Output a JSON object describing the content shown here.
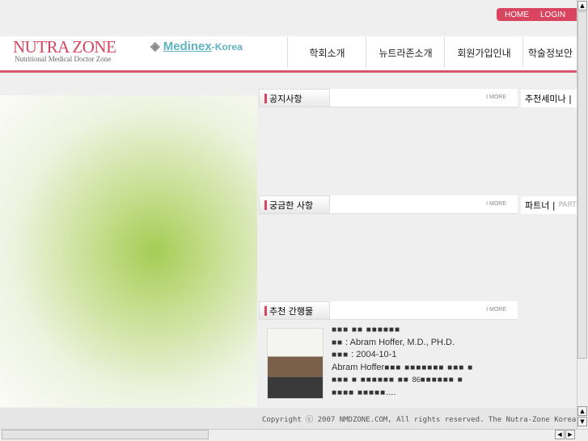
{
  "top_links": [
    "HOME",
    "LOGIN"
  ],
  "logo": {
    "title": "NUTRA ZONE",
    "subtitle": "Nutritional Medical Doctor Zone"
  },
  "partner_logo": {
    "main": "Medinex",
    "suffix": "-Korea"
  },
  "nav": [
    "학회소개",
    "뉴트라존소개",
    "회원가입인내",
    "학술정보안"
  ],
  "sections": {
    "notice": {
      "title": "공지사항",
      "more": "I MORE"
    },
    "faq": {
      "title": "궁금한 사항",
      "more": "I MORE"
    },
    "books": {
      "title": "추천 간행물",
      "more": "I MORE"
    }
  },
  "right": {
    "seminar": "추천세미나 |",
    "partner": "파트너 |",
    "partner_en": "PARTNER"
  },
  "book": {
    "line1": "■■■ ■■ ■■■■■■",
    "author_label": "■■",
    "author": " : Abram Hoffer, M.D., PH.D.",
    "date_label": "■■■",
    "date": " : 2004-10-1",
    "desc_start": "Abram Hoffer",
    "desc1": "■■■ ■■■■■■■ ■■■ ■",
    "desc2": "■■■ ■ ■■■■■■ ■■ ",
    "desc_num": "86",
    "desc3": "■■■■■■ ■",
    "desc4": "■■■■ ■■■■■",
    "ellipsis": "...."
  },
  "footer": "Copyright ⓒ 2007 NMDZONE.COM, All rights reserved. The Nutra-Zone Korea"
}
